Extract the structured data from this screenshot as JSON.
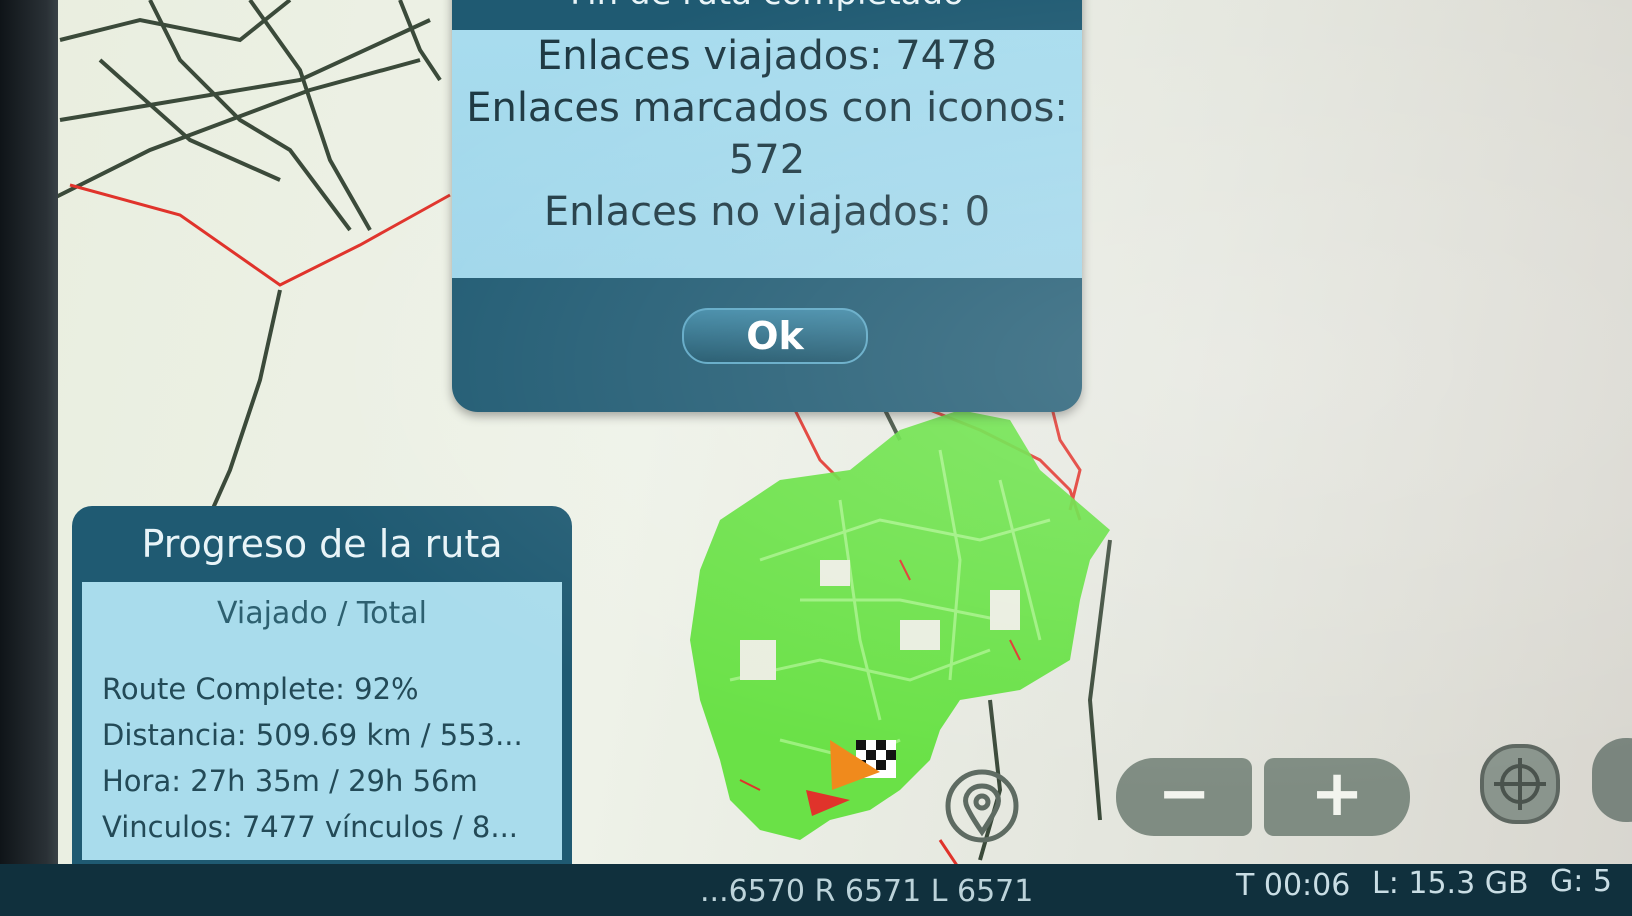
{
  "dialog": {
    "title": "Fin de ruta completado",
    "lines": [
      "Enlaces viajados: 7478",
      "Enlaces marcados con iconos:",
      "572",
      "Enlaces no viajados: 0"
    ],
    "ok_label": "Ok"
  },
  "progress": {
    "title": "Progreso de la ruta",
    "subtitle": "Viajado / Total",
    "stats": [
      "Route Complete: 92%",
      "Distancia: 509.69 km / 553...",
      "Hora: 27h 35m / 29h 56m",
      "Vinculos: 7477 vínculos / 8..."
    ]
  },
  "map_controls": {
    "zoom_out": "−",
    "zoom_in": "+",
    "icons": [
      "location-pin-icon",
      "gps-crosshair-icon",
      "layers-icon",
      "finish-flag-icon",
      "vehicle-arrow-icon"
    ]
  },
  "status_bar": {
    "coords": "...6570 R 6571 L 6571",
    "time": "T 00:06",
    "storage": "L: 15.3 GB",
    "gps": "G: 5"
  },
  "colors": {
    "panel_dark": "#1f5a72",
    "panel_light": "#a9dcec",
    "route_done": "#5ee03a",
    "route_pending": "#e0332b",
    "map_bg": "#e9eedf"
  }
}
